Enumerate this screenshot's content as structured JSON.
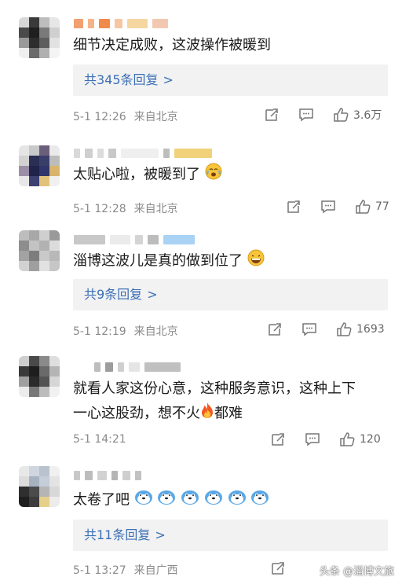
{
  "comments": [
    {
      "text": "细节决定成败，这波操作被暖到",
      "replies": "共345条回复",
      "time": "5-1 12:26",
      "source": "来自北京",
      "likes": "3.6万"
    },
    {
      "text": "太贴心啦，被暖到了",
      "time": "5-1 12:28",
      "source": "来自北京",
      "likes": "77"
    },
    {
      "text": "淄博这波儿是真的做到位了",
      "replies": "共9条回复",
      "time": "5-1 12:19",
      "source": "来自北京",
      "likes": "1693"
    },
    {
      "text_line1": "就看人家这份心意，这种服务意识，这种上下",
      "text_line2": "一心这股劲，想不火",
      "text_line2_end": "都难",
      "time": "5-1 14:21",
      "likes": "120"
    },
    {
      "text": "太卷了吧",
      "replies": "共11条回复",
      "time": "5-1 13:27",
      "source": "来自广西"
    }
  ],
  "reply_arrow": ">",
  "watermark": "头条 @淄博文旅",
  "icons": {
    "share": "share-icon",
    "comment": "comment-icon",
    "like": "like-icon",
    "emoji_teary": "teary-face-emoji",
    "emoji_grin": "grinning-face-emoji",
    "emoji_fire": "fire-emoji",
    "emoji_doge": "doge-face-emoji"
  },
  "colors": {
    "link": "#3b6fb6",
    "meta": "#8a8a8a",
    "reply_bg": "#f2f2f2"
  }
}
